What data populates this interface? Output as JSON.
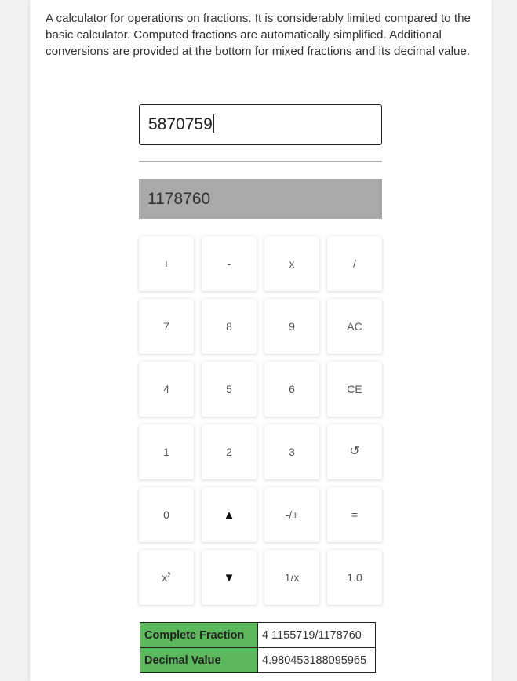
{
  "description": "A calculator for operations on fractions. It is considerably limited compared to the basic calculator. Computed fractions are automatically simplified. Additional conversions are provided at the bottom for mixed fractions and its decimal value.",
  "numerator": {
    "value": "5870759"
  },
  "denominator": {
    "value": "1178760"
  },
  "keypad": {
    "plus": "+",
    "minus": "-",
    "times": "x",
    "divide": "/",
    "seven": "7",
    "eight": "8",
    "nine": "9",
    "all_clear": "AC",
    "four": "4",
    "five": "5",
    "six": "6",
    "clear_entry": "CE",
    "one": "1",
    "two": "2",
    "three": "3",
    "undo": "↺",
    "zero": "0",
    "up": "▲",
    "negate": "-/+",
    "equals": "=",
    "square_base": "x",
    "square_exp": "2",
    "down": "▼",
    "reciprocal": "1/x",
    "decimal_toggle": "1.0"
  },
  "results": {
    "complete_fraction_label": "Complete Fraction",
    "complete_fraction_value": "4 1155719/1178760",
    "decimal_value_label": "Decimal Value",
    "decimal_value_value": "4.980453188095965"
  },
  "colors": {
    "header_cell": "#5cb85c",
    "denominator_bg": "#a9a9a9"
  }
}
